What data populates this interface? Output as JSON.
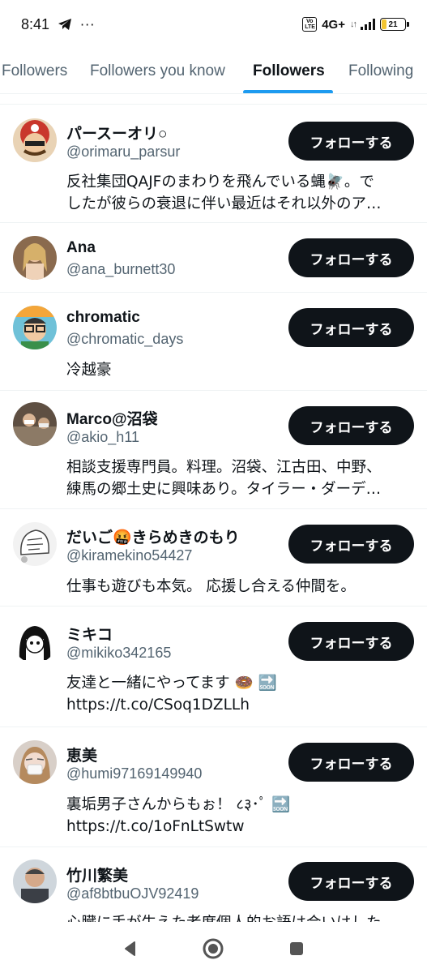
{
  "status_bar": {
    "time": "8:41",
    "dots": "···",
    "volte": "Vo LTE",
    "network": "4G+",
    "battery": "21",
    "battery_level": 0.21
  },
  "tabs": [
    {
      "label": "Followers",
      "active": false
    },
    {
      "label": "Followers you know",
      "active": false
    },
    {
      "label": "Followers",
      "active": true
    },
    {
      "label": "Following",
      "active": false
    }
  ],
  "accent_color": "#1d9bf0",
  "follow_label": "フォローする",
  "users": [
    {
      "name": "パースーオリ○",
      "handle": "@orimaru_parsur",
      "bio": [
        "反社集団QAJFのまわりを飛んでいる蝿🪰。で",
        "したが彼らの衰退に伴い最近はそれ以外のア…"
      ]
    },
    {
      "name": "Ana",
      "handle": "@ana_burnett30",
      "bio": []
    },
    {
      "name": "chromatic",
      "handle": "@chromatic_days",
      "bio": [
        "冷越豪"
      ]
    },
    {
      "name": "Marco@沼袋",
      "handle": "@akio_h11",
      "bio": [
        "相談支援専門員。料理。沼袋、江古田、中野、",
        "練馬の郷土史に興味あり。タイラー・ダーデ…"
      ]
    },
    {
      "name": "だいご🤬きらめきのもり",
      "handle": "@kiramekino54427",
      "bio": [
        "仕事も遊びも本気。 応援し合える仲間を。"
      ]
    },
    {
      "name": "ミキコ",
      "handle": "@mikiko342165",
      "bio": [
        "友達と一緒にやってます 🍩 🔜",
        "https://t.co/CSoq1DZLLh"
      ]
    },
    {
      "name": "恵美",
      "handle": "@humi97169149940",
      "bio": [
        "裏垢男子さんからもぉ！ ८३･ﾟ 🔜",
        "https://t.co/1oFnLtSwtw"
      ]
    },
    {
      "name": "竹川繁美",
      "handle": "@af8btbuOJV92419",
      "bio": [
        "心臓に手が生えた者度個人的お語は合いはした"
      ]
    }
  ]
}
